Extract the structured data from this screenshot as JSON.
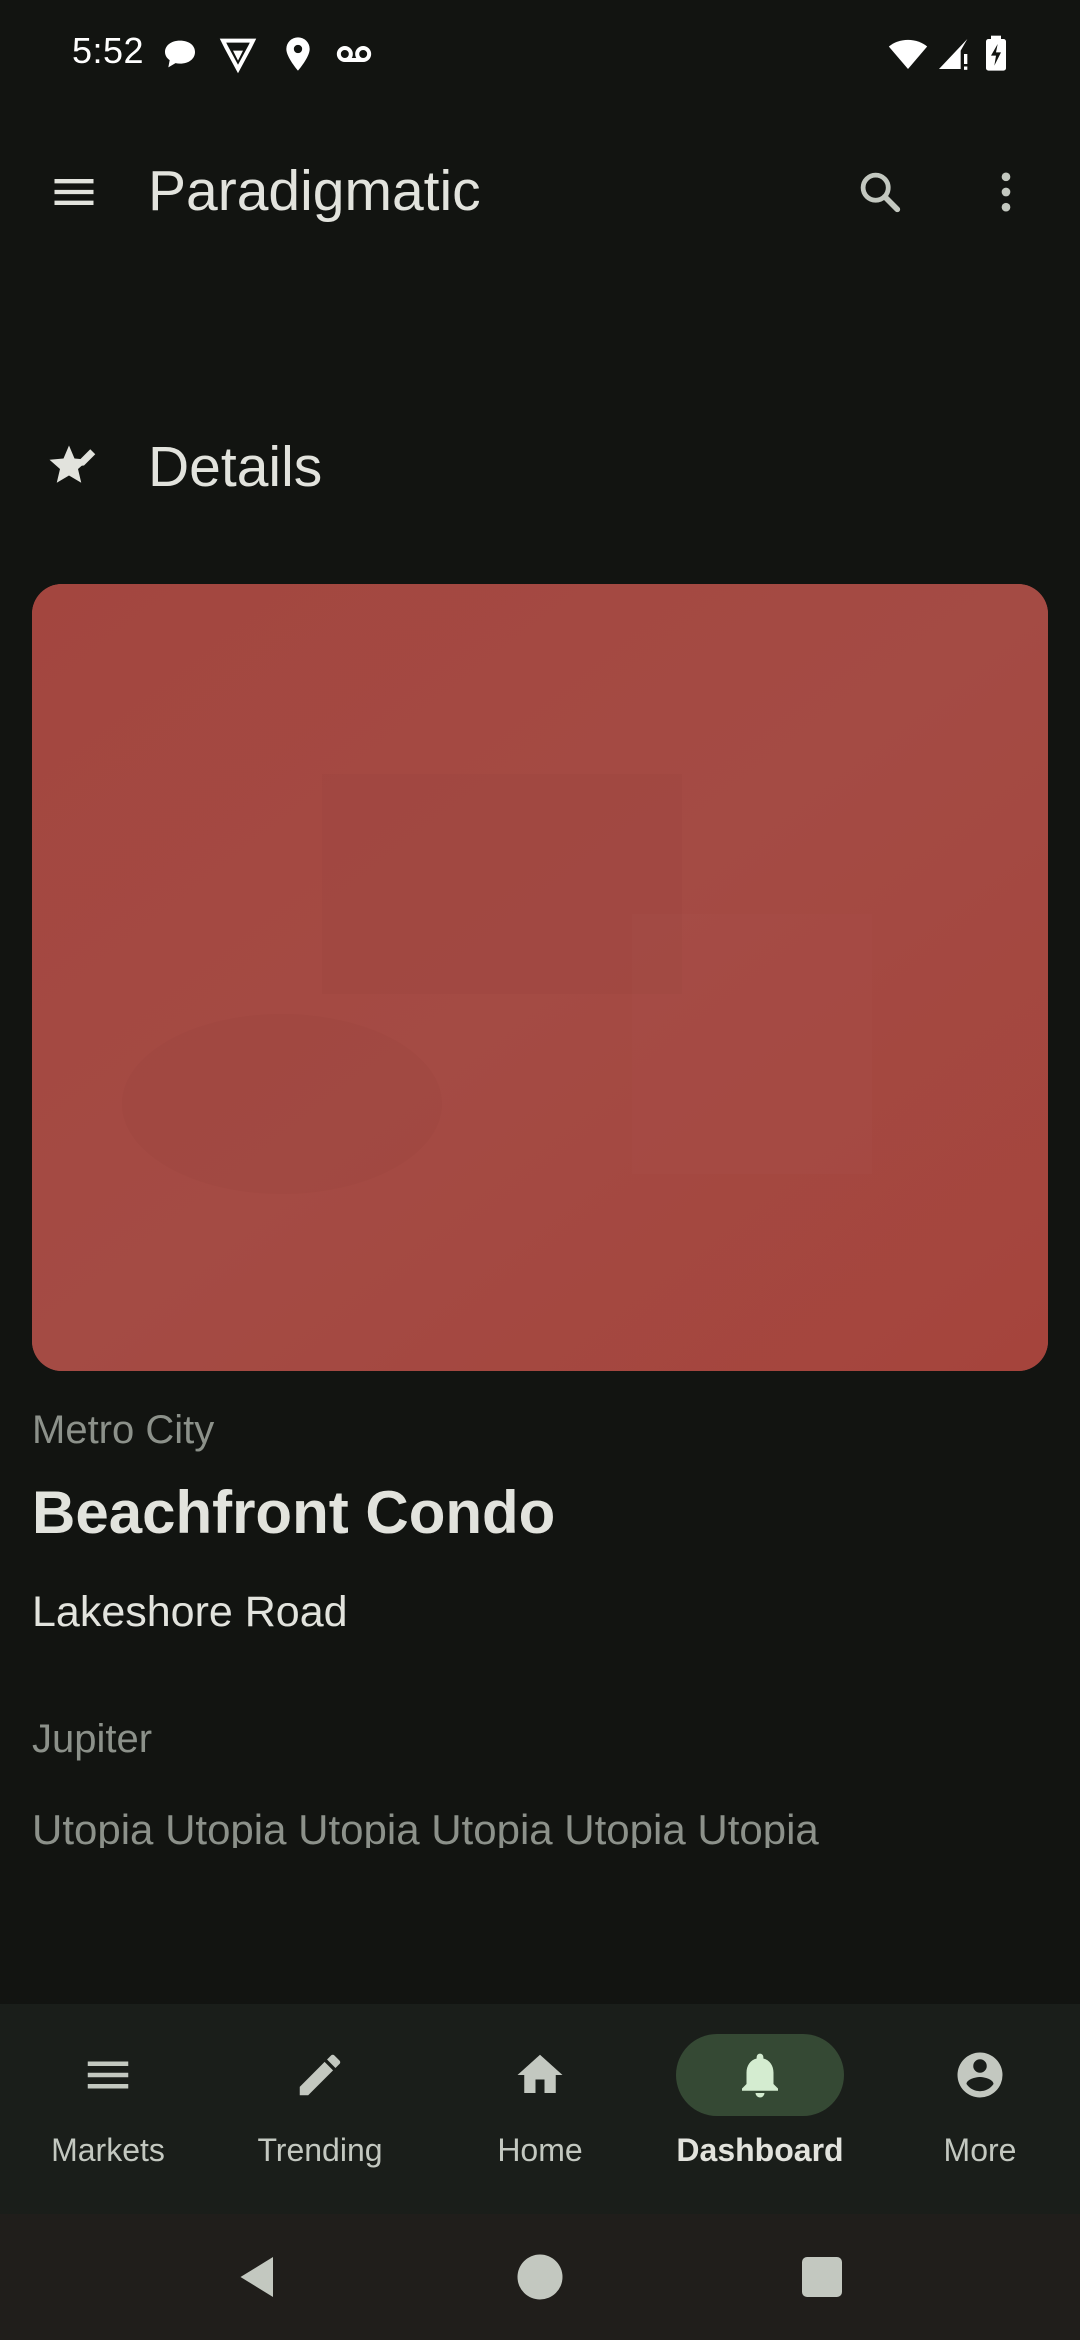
{
  "status_bar": {
    "time": "5:52",
    "left_icons": [
      "chat-bubble-icon",
      "shield-icon",
      "location-pin-icon",
      "voicemail-icon"
    ],
    "right_icons": [
      "wifi-icon",
      "cell-signal-icon",
      "battery-charging-icon"
    ]
  },
  "app_bar": {
    "title": "Paradigmatic",
    "menu_icon": "menu-icon",
    "search_icon": "search-icon",
    "overflow_icon": "more-vert-icon"
  },
  "section": {
    "icon": "star-edit-icon",
    "title": "Details"
  },
  "hero": {
    "icon": "image-placeholder",
    "color": "#a44a43"
  },
  "property": {
    "city": "Metro City",
    "name": "Beachfront Condo",
    "street": "Lakeshore Road",
    "planet": "Jupiter",
    "tags": "Utopia Utopia Utopia Utopia Utopia Utopia"
  },
  "bottom_nav": {
    "items": [
      {
        "label": "Markets",
        "icon": "menu-icon",
        "active": false
      },
      {
        "label": "Trending",
        "icon": "pencil-icon",
        "active": false
      },
      {
        "label": "Home",
        "icon": "home-icon",
        "active": false
      },
      {
        "label": "Dashboard",
        "icon": "bell-icon",
        "active": true
      },
      {
        "label": "More",
        "icon": "account-circle-icon",
        "active": false
      }
    ]
  },
  "system_nav": {
    "buttons": [
      "back-icon",
      "home-circle-icon",
      "recents-icon"
    ]
  },
  "colors": {
    "background": "#121411",
    "on_surface": "#e2e3dd",
    "muted_text": "#8c918a",
    "nav_background": "#1a1e1a",
    "active_pill": "#354934",
    "system_nav_background": "#201e1b"
  }
}
